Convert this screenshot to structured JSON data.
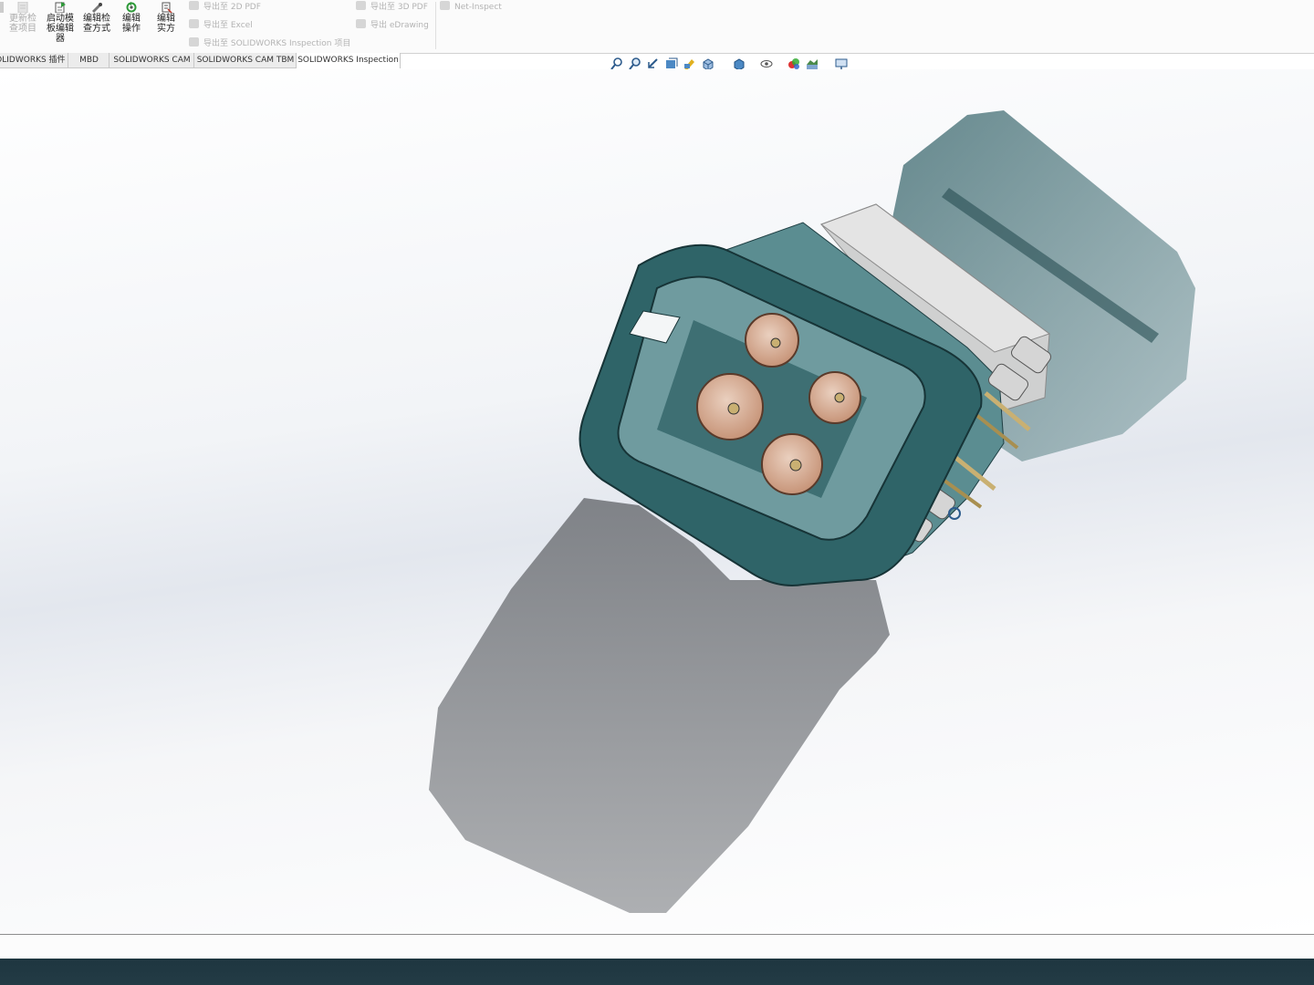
{
  "ribbon": {
    "buttons": [
      {
        "label": "更新检查项目",
        "state": "disabled"
      },
      {
        "label": "启动模板编辑器"
      },
      {
        "label": "编辑检查方式"
      },
      {
        "label": "编辑操作"
      },
      {
        "label": "编辑实方"
      }
    ],
    "export_group_1": [
      {
        "label": "导出至 2D PDF"
      },
      {
        "label": "导出至 Excel"
      },
      {
        "label": "导出至 SOLIDWORKS Inspection 项目"
      }
    ],
    "export_group_2": [
      {
        "label": "导出至 3D PDF"
      },
      {
        "label": "导出 eDrawing"
      }
    ],
    "net_inspect": {
      "label": "Net-Inspect"
    }
  },
  "tabs": [
    {
      "label": "SOLIDWORKS 插件"
    },
    {
      "label": "MBD"
    },
    {
      "label": "SOLIDWORKS CAM"
    },
    {
      "label": "SOLIDWORKS CAM TBM"
    },
    {
      "label": "SOLIDWORKS Inspection",
      "active": true
    }
  ],
  "heads_up_toolbar": {
    "icons": [
      "zoom-to-fit-icon",
      "zoom-to-area-icon",
      "previous-view-icon",
      "section-view-icon",
      "dynamic-annotation-icon",
      "view-orientation-icon",
      "display-style-icon",
      "hide-show-icon",
      "edit-appearance-icon",
      "apply-scene-icon",
      "view-settings-icon"
    ]
  },
  "viewport": {
    "model": "connector-assembly",
    "colors": {
      "housing": "#2f6468",
      "housing_light": "#5e9095",
      "contact": "#d9b099",
      "pin": "#c9b072",
      "shield": "#c9c9c9"
    }
  }
}
